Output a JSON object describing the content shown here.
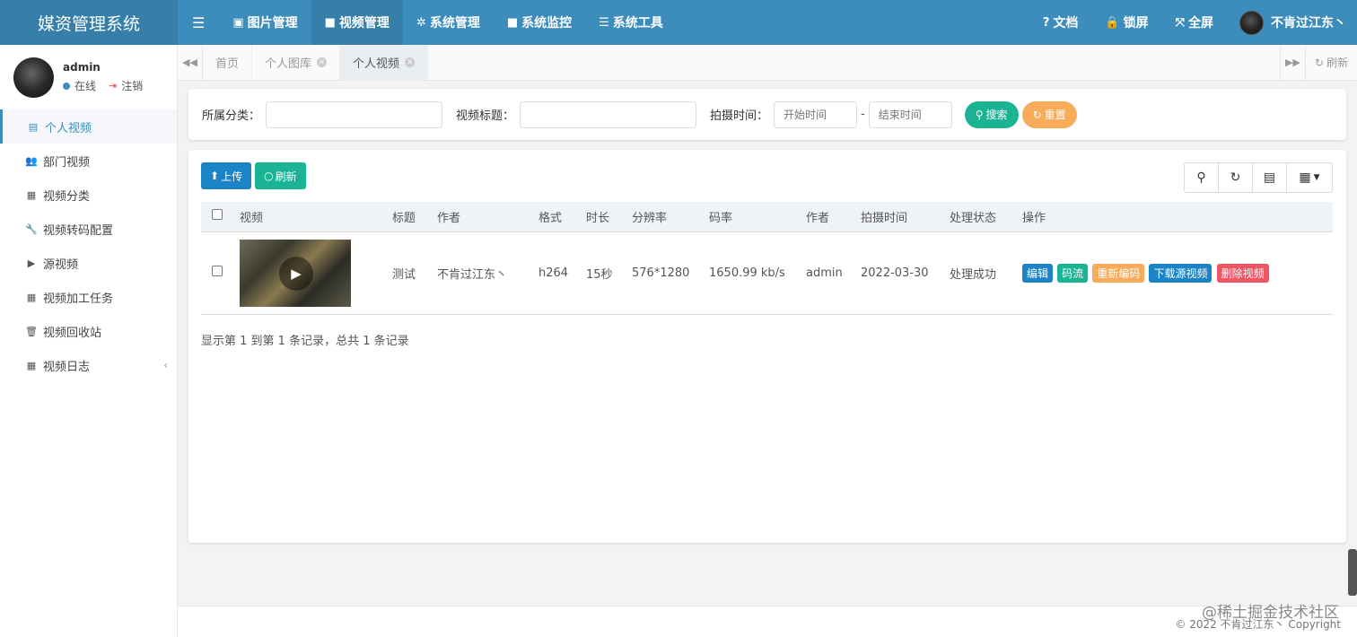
{
  "app": {
    "title": "媒资管理系统"
  },
  "topnav": {
    "items": [
      {
        "icon": "image-icon",
        "glyph": "▣",
        "label": "图片管理"
      },
      {
        "icon": "video-camera-icon",
        "glyph": "■",
        "label": "视频管理"
      },
      {
        "icon": "gear-icon",
        "glyph": "✲",
        "label": "系统管理"
      },
      {
        "icon": "monitor-icon",
        "glyph": "■",
        "label": "系统监控"
      },
      {
        "icon": "list-icon",
        "glyph": "☰",
        "label": "系统工具"
      }
    ],
    "right": [
      {
        "icon": "question-icon",
        "glyph": "?",
        "label": "文档"
      },
      {
        "icon": "lock-icon",
        "glyph": "🔒",
        "label": "锁屏"
      },
      {
        "icon": "fullscreen-icon",
        "glyph": "⤧",
        "label": "全屏"
      }
    ],
    "user": "不肯过江东丶"
  },
  "sidebar": {
    "user": {
      "name": "admin",
      "status": "在线",
      "logout": "注销"
    },
    "items": [
      {
        "icon": "file-video-icon",
        "glyph": "▤",
        "label": "个人视频"
      },
      {
        "icon": "users-icon",
        "glyph": "👥",
        "label": "部门视频"
      },
      {
        "icon": "calendar-icon",
        "glyph": "▦",
        "label": "视频分类"
      },
      {
        "icon": "wrench-icon",
        "glyph": "🔧",
        "label": "视频转码配置"
      },
      {
        "icon": "play-square-icon",
        "glyph": "▶",
        "label": "源视频"
      },
      {
        "icon": "calendar-icon",
        "glyph": "▦",
        "label": "视频加工任务"
      },
      {
        "icon": "trash-icon",
        "glyph": "🗑",
        "label": "视频回收站"
      },
      {
        "icon": "calendar-icon",
        "glyph": "▦",
        "label": "视频日志"
      }
    ]
  },
  "tabs": {
    "items": [
      {
        "label": "首页"
      },
      {
        "label": "个人图库"
      },
      {
        "label": "个人视频"
      }
    ],
    "refresh": "刷新"
  },
  "search": {
    "category_label": "所属分类：",
    "title_label": "视频标题：",
    "time_label": "拍摄时间：",
    "start_placeholder": "开始时间",
    "end_placeholder": "结束时间",
    "separator": "-",
    "search_btn": "搜索",
    "reset_btn": "重置"
  },
  "toolbar": {
    "upload": "上传",
    "refresh": "刷新"
  },
  "table": {
    "headers": [
      "视频",
      "标题",
      "作者",
      "格式",
      "时长",
      "分辨率",
      "码率",
      "作者",
      "拍摄时间",
      "处理状态",
      "操作"
    ],
    "rows": [
      {
        "title": "测试",
        "author": "不肯过江东丶",
        "format": "h264",
        "duration": "15秒",
        "resolution": "576*1280",
        "bitrate": "1650.99 kb/s",
        "creator": "admin",
        "shot_time": "2022-03-30",
        "status": "处理成功",
        "actions": {
          "edit": "编辑",
          "stream": "码流",
          "reencode": "重新编码",
          "download": "下载源视频",
          "delete": "删除视频"
        }
      }
    ]
  },
  "pagination": {
    "info": "显示第 1 到第 1 条记录，总共 1 条记录"
  },
  "footer": {
    "copyright": "© 2022 不肯过江东丶 Copyright"
  },
  "watermark": "@稀土掘金技术社区",
  "colors": {
    "header": "#3c8dbc",
    "success": "#1ab394",
    "warning": "#f8ac59",
    "primary": "#1c84c6",
    "danger": "#ed5565"
  }
}
